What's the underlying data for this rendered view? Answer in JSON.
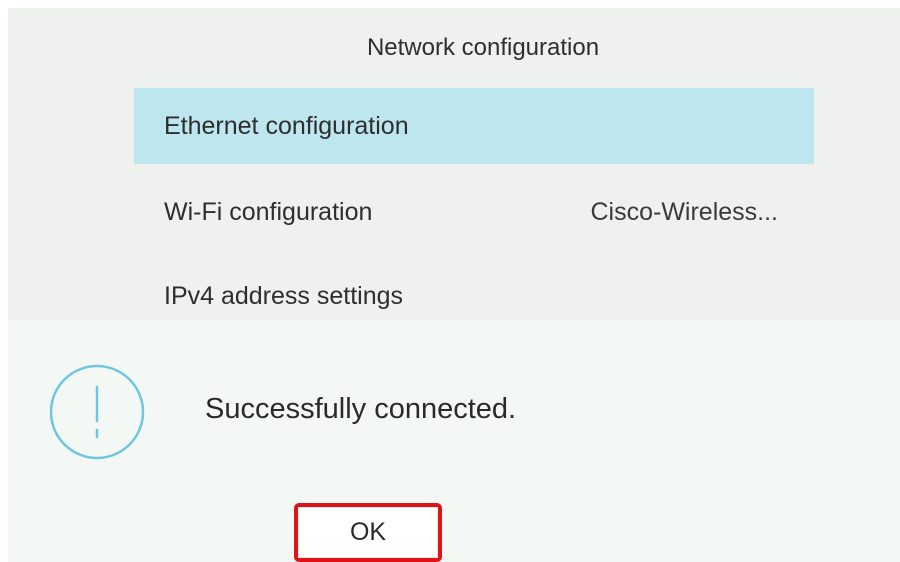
{
  "menu": {
    "title": "Network configuration",
    "items": [
      {
        "label": "Ethernet configuration",
        "value": "",
        "selected": true
      },
      {
        "label": "Wi-Fi configuration",
        "value": "Cisco-Wireless...",
        "selected": false
      },
      {
        "label": "IPv4 address settings",
        "value": "",
        "selected": false
      }
    ]
  },
  "dialog": {
    "icon": "exclamation-circle-icon",
    "message": "Successfully connected.",
    "ok_label": "OK"
  },
  "colors": {
    "selection": "#bee6ef",
    "icon_stroke": "#6fc6df",
    "highlight_border": "#e0131b"
  }
}
